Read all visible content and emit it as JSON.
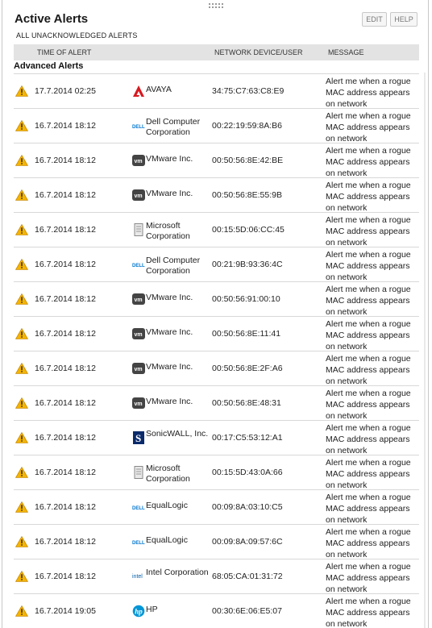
{
  "widget": {
    "title": "Active Alerts",
    "subtitle": "ALL UNACKNOWLEDGED ALERTS",
    "edit_label": "EDIT",
    "help_label": "HELP"
  },
  "columns": {
    "time": "TIME OF ALERT",
    "device": "NETWORK DEVICE/USER",
    "message": "MESSAGE"
  },
  "section": "Advanced Alerts",
  "colors": {
    "warning": "#f5b400",
    "avaya": "#d71920",
    "dell": "#0076ce",
    "vmware": "#444444",
    "sonicwall": "#0a2a6b",
    "intel": "#0860a8",
    "hp": "#0096d6"
  },
  "rows": [
    {
      "time": "17.7.2014 02:25",
      "vendor_icon": "avaya-logo-icon",
      "vendor": "AVAYA",
      "device": "34:75:C7:63:C8:E9",
      "message": "Alert me when a rogue MAC address appears on network"
    },
    {
      "time": "16.7.2014 18:12",
      "vendor_icon": "dell-logo-icon",
      "vendor": "Dell Computer Corporation",
      "device": "00:22:19:59:8A:B6",
      "message": "Alert me when a rogue MAC address appears on network"
    },
    {
      "time": "16.7.2014 18:12",
      "vendor_icon": "vmware-logo-icon",
      "vendor": "VMware Inc.",
      "device": "00:50:56:8E:42:BE",
      "message": "Alert me when a rogue MAC address appears on network"
    },
    {
      "time": "16.7.2014 18:12",
      "vendor_icon": "vmware-logo-icon",
      "vendor": "VMware Inc.",
      "device": "00:50:56:8E:55:9B",
      "message": "Alert me when a rogue MAC address appears on network"
    },
    {
      "time": "16.7.2014 18:12",
      "vendor_icon": "microsoft-logo-icon",
      "vendor": "Microsoft Corporation",
      "device": "00:15:5D:06:CC:45",
      "message": "Alert me when a rogue MAC address appears on network"
    },
    {
      "time": "16.7.2014 18:12",
      "vendor_icon": "dell-logo-icon",
      "vendor": "Dell Computer Corporation",
      "device": "00:21:9B:93:36:4C",
      "message": "Alert me when a rogue MAC address appears on network"
    },
    {
      "time": "16.7.2014 18:12",
      "vendor_icon": "vmware-logo-icon",
      "vendor": "VMware Inc.",
      "device": "00:50:56:91:00:10",
      "message": "Alert me when a rogue MAC address appears on network"
    },
    {
      "time": "16.7.2014 18:12",
      "vendor_icon": "vmware-logo-icon",
      "vendor": "VMware Inc.",
      "device": "00:50:56:8E:11:41",
      "message": "Alert me when a rogue MAC address appears on network"
    },
    {
      "time": "16.7.2014 18:12",
      "vendor_icon": "vmware-logo-icon",
      "vendor": "VMware Inc.",
      "device": "00:50:56:8E:2F:A6",
      "message": "Alert me when a rogue MAC address appears on network"
    },
    {
      "time": "16.7.2014 18:12",
      "vendor_icon": "vmware-logo-icon",
      "vendor": "VMware Inc.",
      "device": "00:50:56:8E:48:31",
      "message": "Alert me when a rogue MAC address appears on network"
    },
    {
      "time": "16.7.2014 18:12",
      "vendor_icon": "sonicwall-logo-icon",
      "vendor": "SonicWALL, Inc.",
      "device": "00:17:C5:53:12:A1",
      "message": "Alert me when a rogue MAC address appears on network"
    },
    {
      "time": "16.7.2014 18:12",
      "vendor_icon": "microsoft-logo-icon",
      "vendor": "Microsoft Corporation",
      "device": "00:15:5D:43:0A:66",
      "message": "Alert me when a rogue MAC address appears on network"
    },
    {
      "time": "16.7.2014 18:12",
      "vendor_icon": "dell-logo-icon",
      "vendor": "EqualLogic",
      "device": "00:09:8A:03:10:C5",
      "message": "Alert me when a rogue MAC address appears on network"
    },
    {
      "time": "16.7.2014 18:12",
      "vendor_icon": "dell-logo-icon",
      "vendor": "EqualLogic",
      "device": "00:09:8A:09:57:6C",
      "message": "Alert me when a rogue MAC address appears on network"
    },
    {
      "time": "16.7.2014 18:12",
      "vendor_icon": "intel-logo-icon",
      "vendor": "Intel Corporation",
      "device": "68:05:CA:01:31:72",
      "message": "Alert me when a rogue MAC address appears on network"
    },
    {
      "time": "16.7.2014 19:05",
      "vendor_icon": "hp-logo-icon",
      "vendor": "HP",
      "device": "00:30:6E:06:E5:07",
      "message": "Alert me when a rogue MAC address appears on network"
    }
  ]
}
